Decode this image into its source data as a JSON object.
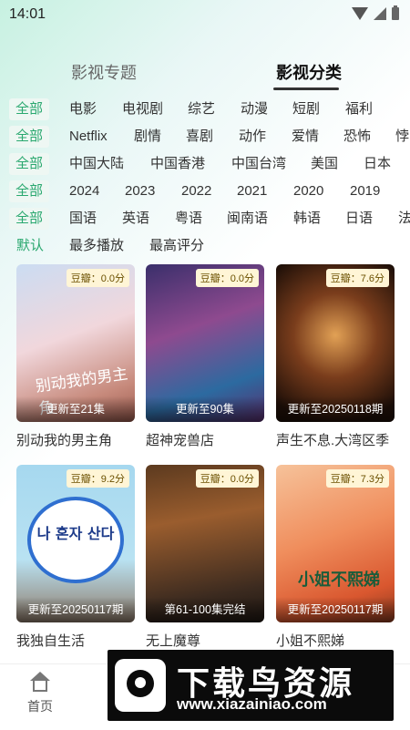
{
  "status": {
    "time": "14:01"
  },
  "top_tabs": [
    {
      "label": "影视专题",
      "active": false
    },
    {
      "label": "影视分类",
      "active": true
    }
  ],
  "filters": [
    {
      "active": "全部",
      "options": [
        "电影",
        "电视剧",
        "综艺",
        "动漫",
        "短剧",
        "福利"
      ]
    },
    {
      "active": "全部",
      "options": [
        "Netflix",
        "剧情",
        "喜剧",
        "动作",
        "爱情",
        "恐怖",
        "悖"
      ]
    },
    {
      "active": "全部",
      "options": [
        "中国大陆",
        "中国香港",
        "中国台湾",
        "美国",
        "日本"
      ]
    },
    {
      "active": "全部",
      "options": [
        "2024",
        "2023",
        "2022",
        "2021",
        "2020",
        "2019"
      ]
    },
    {
      "active": "全部",
      "options": [
        "国语",
        "英语",
        "粤语",
        "闽南语",
        "韩语",
        "日语",
        "法"
      ]
    }
  ],
  "sort": {
    "options": [
      "默认",
      "最多播放",
      "最高评分"
    ],
    "active": "默认"
  },
  "cards": [
    {
      "title": "别动我的男主角",
      "rating": "豆瓣：0.0分",
      "update": "更新至21集",
      "poster_text": "别动我的男主角"
    },
    {
      "title": "超神宠兽店",
      "rating": "豆瓣：0.0分",
      "update": "更新至90集",
      "poster_text": ""
    },
    {
      "title": "声生不息.大湾区季",
      "rating": "豆瓣：7.6分",
      "update": "更新至20250118期",
      "poster_text": ""
    },
    {
      "title": "我独自生活",
      "rating": "豆瓣：9.2分",
      "update": "更新至20250117期",
      "poster_text": "나 혼자 산다"
    },
    {
      "title": "无上魔尊",
      "rating": "豆瓣：0.0分",
      "update": "第61-100集完结",
      "poster_text": ""
    },
    {
      "title": "小姐不熙娣",
      "rating": "豆瓣：7.3分",
      "update": "更新至20250117期",
      "poster_text": "小姐不熙娣"
    }
  ],
  "bottom_nav": {
    "home": "首页"
  },
  "watermark": {
    "title": "下载鸟资源",
    "url": "www.xiazainiao.com"
  },
  "colors": {
    "accent": "#2aa86f",
    "chip_bg": "#eef7f3"
  }
}
